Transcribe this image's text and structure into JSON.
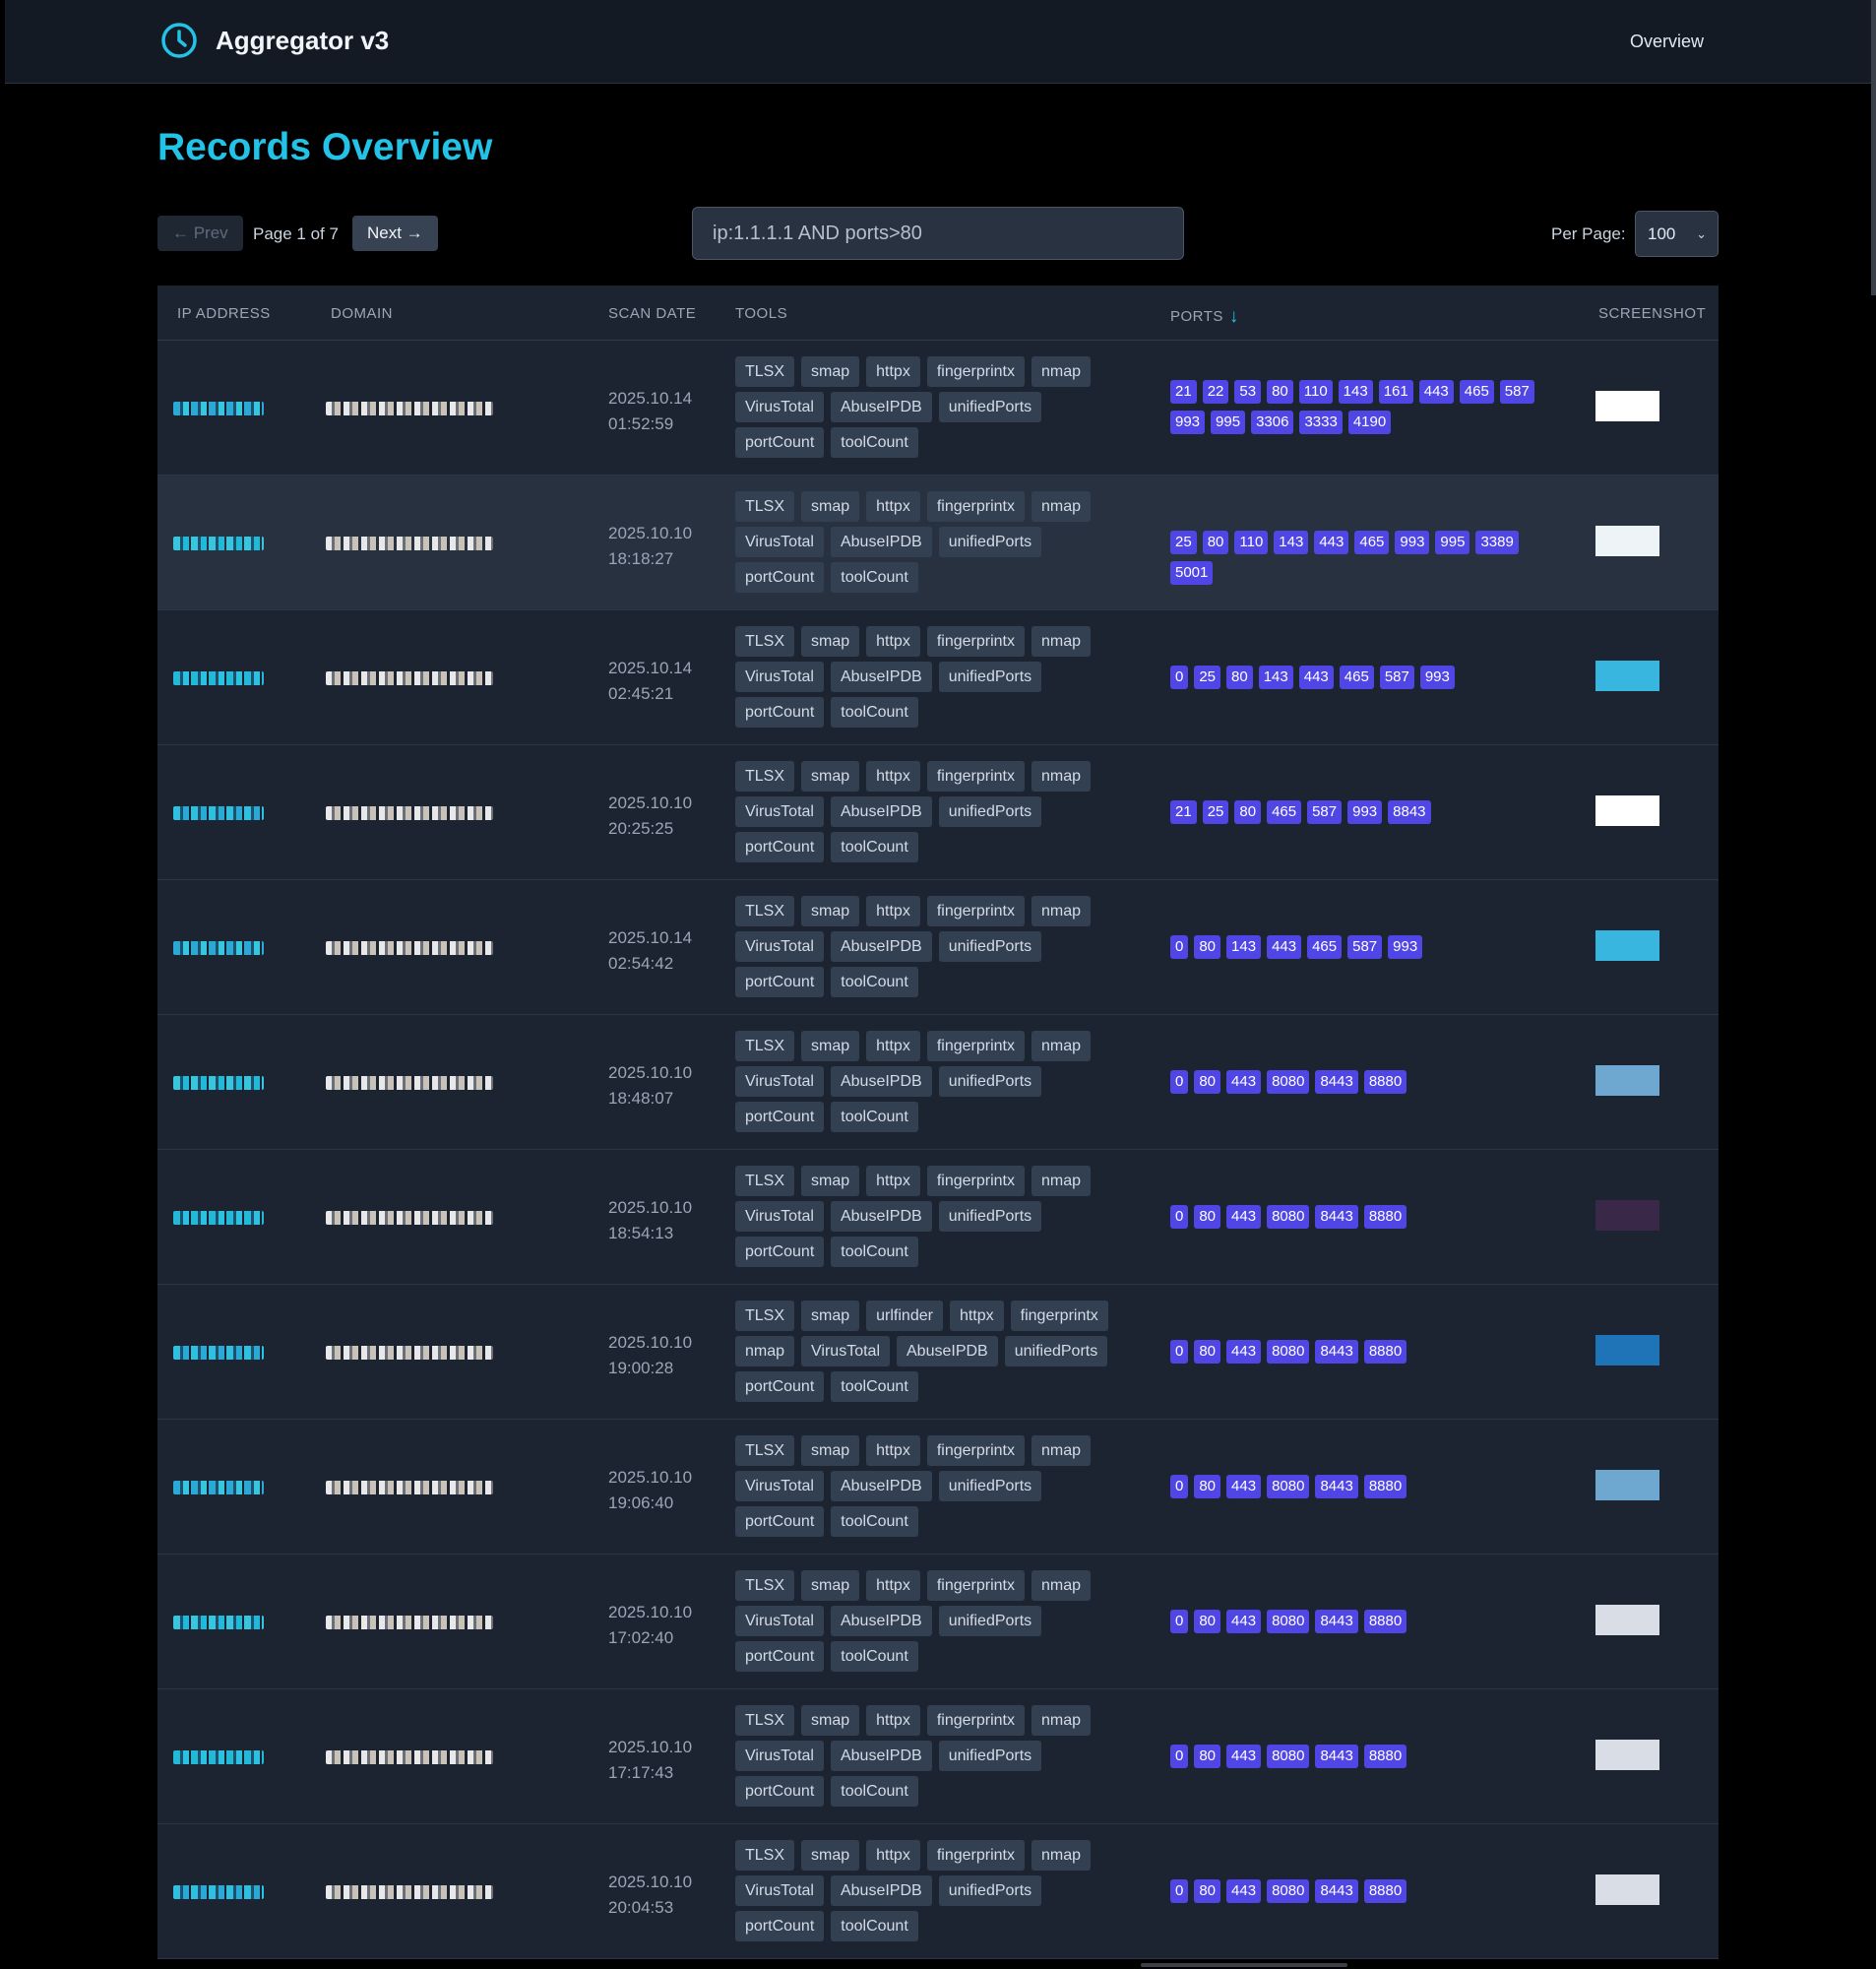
{
  "app": {
    "title": "Aggregator v3",
    "nav_overview": "Overview"
  },
  "page": {
    "title": "Records Overview"
  },
  "pagination": {
    "prev_label": "← Prev",
    "page_info": "Page 1 of 7",
    "next_label": "Next →"
  },
  "search": {
    "value": "ip:1.1.1.1 AND ports>80"
  },
  "per_page": {
    "label": "Per Page:",
    "value": "100"
  },
  "columns": {
    "ip": "IP ADDRESS",
    "domain": "DOMAIN",
    "scan_date": "SCAN DATE",
    "tools": "TOOLS",
    "ports": "PORTS",
    "screenshot": "SCREENSHOT"
  },
  "colors": {
    "accent": "#22c3e6",
    "port_badge": "#4f46e5",
    "tool_badge": "#334052"
  },
  "icons": {
    "brand": "clock-icon",
    "sort": "arrow-down-icon",
    "select": "chevron-down-icon"
  },
  "rows": [
    {
      "date": "2025.10.14",
      "time": "01:52:59",
      "tools": [
        "TLSX",
        "smap",
        "httpx",
        "fingerprintx",
        "nmap",
        "VirusTotal",
        "AbuseIPDB",
        "unifiedPorts",
        "portCount",
        "toolCount"
      ],
      "ports": [
        "21",
        "22",
        "53",
        "80",
        "110",
        "143",
        "161",
        "443",
        "465",
        "587",
        "993",
        "995",
        "3306",
        "3333",
        "4190"
      ],
      "shot_color": "#ffffff"
    },
    {
      "date": "2025.10.10",
      "time": "18:18:27",
      "tools": [
        "TLSX",
        "smap",
        "httpx",
        "fingerprintx",
        "nmap",
        "VirusTotal",
        "AbuseIPDB",
        "unifiedPorts",
        "portCount",
        "toolCount"
      ],
      "ports": [
        "25",
        "80",
        "110",
        "143",
        "443",
        "465",
        "993",
        "995",
        "3389",
        "5001"
      ],
      "shot_color": "#eef3f8"
    },
    {
      "date": "2025.10.14",
      "time": "02:45:21",
      "tools": [
        "TLSX",
        "smap",
        "httpx",
        "fingerprintx",
        "nmap",
        "VirusTotal",
        "AbuseIPDB",
        "unifiedPorts",
        "portCount",
        "toolCount"
      ],
      "ports": [
        "0",
        "25",
        "80",
        "143",
        "443",
        "465",
        "587",
        "993"
      ],
      "shot_color": "#38b6e0"
    },
    {
      "date": "2025.10.10",
      "time": "20:25:25",
      "tools": [
        "TLSX",
        "smap",
        "httpx",
        "fingerprintx",
        "nmap",
        "VirusTotal",
        "AbuseIPDB",
        "unifiedPorts",
        "portCount",
        "toolCount"
      ],
      "ports": [
        "21",
        "25",
        "80",
        "465",
        "587",
        "993",
        "8843"
      ],
      "shot_color": "#ffffff"
    },
    {
      "date": "2025.10.14",
      "time": "02:54:42",
      "tools": [
        "TLSX",
        "smap",
        "httpx",
        "fingerprintx",
        "nmap",
        "VirusTotal",
        "AbuseIPDB",
        "unifiedPorts",
        "portCount",
        "toolCount"
      ],
      "ports": [
        "0",
        "80",
        "143",
        "443",
        "465",
        "587",
        "993"
      ],
      "shot_color": "#38b6e0"
    },
    {
      "date": "2025.10.10",
      "time": "18:48:07",
      "tools": [
        "TLSX",
        "smap",
        "httpx",
        "fingerprintx",
        "nmap",
        "VirusTotal",
        "AbuseIPDB",
        "unifiedPorts",
        "portCount",
        "toolCount"
      ],
      "ports": [
        "0",
        "80",
        "443",
        "8080",
        "8443",
        "8880"
      ],
      "shot_color": "#6ea7cf"
    },
    {
      "date": "2025.10.10",
      "time": "18:54:13",
      "tools": [
        "TLSX",
        "smap",
        "httpx",
        "fingerprintx",
        "nmap",
        "VirusTotal",
        "AbuseIPDB",
        "unifiedPorts",
        "portCount",
        "toolCount"
      ],
      "ports": [
        "0",
        "80",
        "443",
        "8080",
        "8443",
        "8880"
      ],
      "shot_color": "#3a2848"
    },
    {
      "date": "2025.10.10",
      "time": "19:00:28",
      "tools": [
        "TLSX",
        "smap",
        "urlfinder",
        "httpx",
        "fingerprintx",
        "nmap",
        "VirusTotal",
        "AbuseIPDB",
        "unifiedPorts",
        "portCount",
        "toolCount"
      ],
      "ports": [
        "0",
        "80",
        "443",
        "8080",
        "8443",
        "8880"
      ],
      "shot_color": "#1f74b8"
    },
    {
      "date": "2025.10.10",
      "time": "19:06:40",
      "tools": [
        "TLSX",
        "smap",
        "httpx",
        "fingerprintx",
        "nmap",
        "VirusTotal",
        "AbuseIPDB",
        "unifiedPorts",
        "portCount",
        "toolCount"
      ],
      "ports": [
        "0",
        "80",
        "443",
        "8080",
        "8443",
        "8880"
      ],
      "shot_color": "#6ea7cf"
    },
    {
      "date": "2025.10.10",
      "time": "17:02:40",
      "tools": [
        "TLSX",
        "smap",
        "httpx",
        "fingerprintx",
        "nmap",
        "VirusTotal",
        "AbuseIPDB",
        "unifiedPorts",
        "portCount",
        "toolCount"
      ],
      "ports": [
        "0",
        "80",
        "443",
        "8080",
        "8443",
        "8880"
      ],
      "shot_color": "#d9dee6"
    },
    {
      "date": "2025.10.10",
      "time": "17:17:43",
      "tools": [
        "TLSX",
        "smap",
        "httpx",
        "fingerprintx",
        "nmap",
        "VirusTotal",
        "AbuseIPDB",
        "unifiedPorts",
        "portCount",
        "toolCount"
      ],
      "ports": [
        "0",
        "80",
        "443",
        "8080",
        "8443",
        "8880"
      ],
      "shot_color": "#d9dee6"
    },
    {
      "date": "2025.10.10",
      "time": "20:04:53",
      "tools": [
        "TLSX",
        "smap",
        "httpx",
        "fingerprintx",
        "nmap",
        "VirusTotal",
        "AbuseIPDB",
        "unifiedPorts",
        "portCount",
        "toolCount"
      ],
      "ports": [
        "0",
        "80",
        "443",
        "8080",
        "8443",
        "8880"
      ],
      "shot_color": "#d9dee6"
    }
  ]
}
